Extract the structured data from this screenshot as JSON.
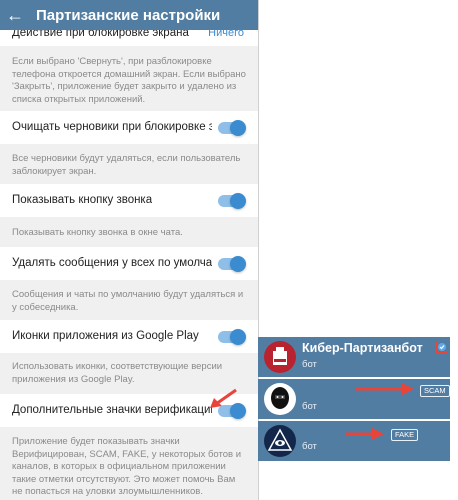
{
  "appbar": {
    "back_icon": "arrow-left-icon",
    "title": "Партизанские настройки"
  },
  "settings": {
    "lock_action": {
      "label": "Действие при блокировке экрана",
      "value": "Ничего",
      "desc": "Если выбрано 'Свернуть', при разблокировке телефона откроется домашний экран. Если выбрано 'Закрыть', приложение будет закрыто и удалено из списка открытых приложений."
    },
    "clear_drafts": {
      "label": "Очищать черновики при блокировке экрана",
      "enabled": true,
      "desc": "Все черновики будут удаляться, если пользователь заблокирует экран."
    },
    "call_button": {
      "label": "Показывать кнопку звонка",
      "enabled": true,
      "desc": "Показывать кнопку звонка в окне чата."
    },
    "delete_for_all": {
      "label": "Удалять сообщения у всех по умолчанию",
      "enabled": true,
      "desc": "Сообщения и чаты по умолчанию будут удаляться и у собеседника."
    },
    "gp_icons": {
      "label": "Иконки приложения из Google Play",
      "enabled": true,
      "desc": "Использовать иконки, соответствующие версии приложения из Google Play."
    },
    "extra_badges": {
      "label": "Дополнительные значки верификации",
      "enabled": true,
      "desc": "Приложение будет показывать значки Верифицирован, SCAM, FAKE, у некоторых ботов и каналов, в которых в официальном приложении такие отметки отсутствуют. Это может помочь Вам не попасться на уловки злоумышленников."
    }
  },
  "badges": [
    {
      "name": "Кибер-Партизанбот",
      "sub": "бот",
      "tag": "",
      "icon": "verified-icon"
    },
    {
      "name": "",
      "sub": "бот",
      "tag": "SCAM",
      "icon": "red-arrow-icon"
    },
    {
      "name": "",
      "sub": "бот",
      "tag": "FAKE",
      "icon": "red-arrow-icon"
    }
  ],
  "colors": {
    "appbar": "#527da3",
    "accent": "#3a8bd0",
    "arrow": "#e8443a"
  }
}
